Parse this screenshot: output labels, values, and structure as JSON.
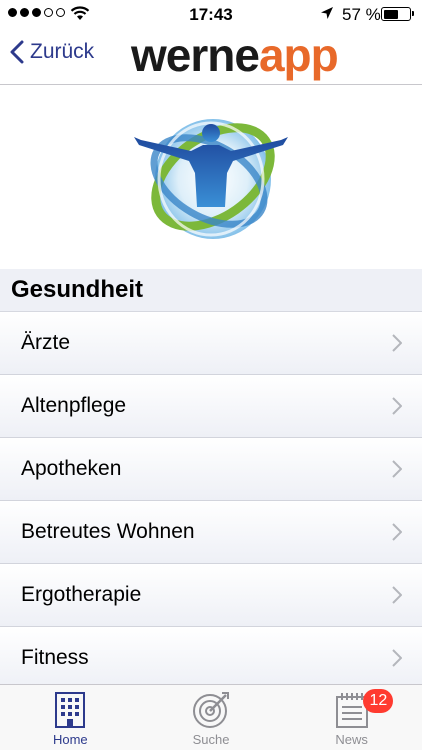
{
  "status_bar": {
    "time": "17:43",
    "battery_percent": "57 %",
    "battery_level": 0.57,
    "signal_bars": 3
  },
  "nav": {
    "back_label": "Zurück",
    "logo_part1": "werne",
    "logo_part2": "app"
  },
  "section": {
    "title": "Gesundheit"
  },
  "list": {
    "items": [
      {
        "label": "Ärzte"
      },
      {
        "label": "Altenpflege"
      },
      {
        "label": "Apotheken"
      },
      {
        "label": "Betreutes Wohnen"
      },
      {
        "label": "Ergotherapie"
      },
      {
        "label": "Fitness"
      }
    ]
  },
  "tabs": {
    "home": "Home",
    "search": "Suche",
    "news": "News",
    "news_badge": "12"
  },
  "colors": {
    "accent": "#2d3a8c",
    "logo_orange": "#e8692a",
    "badge_red": "#ff3b30"
  }
}
